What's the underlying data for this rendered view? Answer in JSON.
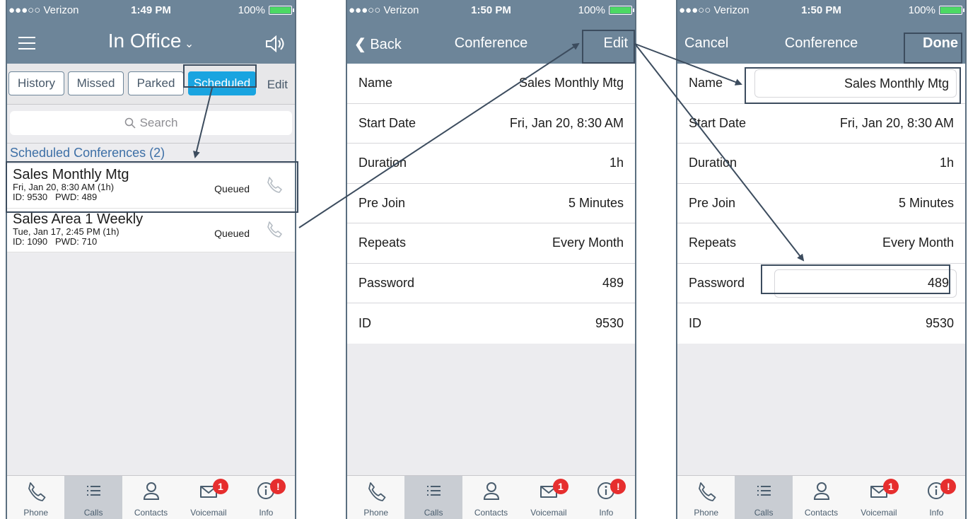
{
  "status": {
    "carrier": "●●●○○ Verizon",
    "battery": "100%",
    "time1": "1:49 PM",
    "time2": "1:50 PM",
    "time3": "1:50 PM"
  },
  "screen1": {
    "title": "In Office",
    "segments": [
      "History",
      "Missed",
      "Parked",
      "Scheduled"
    ],
    "edit": "Edit",
    "search_placeholder": "Search",
    "section": "Scheduled Conferences (2)",
    "conferences": [
      {
        "name": "Sales Monthly Mtg",
        "when": "Fri, Jan 20, 8:30 AM (1h)",
        "ids": "ID: 9530   PWD: 489",
        "status": "Queued"
      },
      {
        "name": "Sales Area 1 Weekly",
        "when": "Tue, Jan 17, 2:45 PM (1h)",
        "ids": "ID: 1090   PWD: 710",
        "status": "Queued"
      }
    ]
  },
  "screen2": {
    "back": "Back",
    "title": "Conference",
    "edit": "Edit"
  },
  "screen3": {
    "cancel": "Cancel",
    "title": "Conference",
    "done": "Done"
  },
  "details": [
    {
      "label": "Name",
      "value": "Sales Monthly Mtg"
    },
    {
      "label": "Start Date",
      "value": "Fri, Jan 20, 8:30 AM"
    },
    {
      "label": "Duration",
      "value": "1h"
    },
    {
      "label": "Pre Join",
      "value": "5 Minutes"
    },
    {
      "label": "Repeats",
      "value": "Every Month"
    },
    {
      "label": "Password",
      "value": "489"
    },
    {
      "label": "ID",
      "value": "9530"
    }
  ],
  "tabs": [
    {
      "label": "Phone",
      "icon": "phone-icon"
    },
    {
      "label": "Calls",
      "icon": "list-icon"
    },
    {
      "label": "Contacts",
      "icon": "person-icon"
    },
    {
      "label": "Voicemail",
      "icon": "envelope-icon",
      "badge": "1"
    },
    {
      "label": "Info",
      "icon": "info-icon",
      "badge": "!"
    }
  ],
  "colors": {
    "header": "#6d8599",
    "accent": "#19a4e0",
    "badge": "#e62e2e",
    "annotation": "#3c4c5e"
  }
}
